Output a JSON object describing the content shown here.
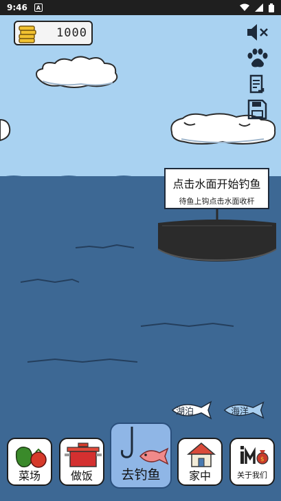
{
  "status_bar": {
    "time": "9:46",
    "notification": "A"
  },
  "coins": {
    "amount": "1000"
  },
  "side_icons": [
    "sound-off-icon",
    "paw-icon",
    "notes-icon",
    "save-icon"
  ],
  "tooltip": {
    "title": "点击水面开始钓鱼",
    "subtitle": "待鱼上钩点击水面收杆"
  },
  "fish_tags": {
    "lake": "湖泊",
    "ocean": "海洋"
  },
  "nav": {
    "vegetables": "菜场",
    "cooking": "做饭",
    "fishing": "去钓鱼",
    "home": "家中",
    "about": "关于我们"
  },
  "colors": {
    "sky": "#a9d2f1",
    "sea": "#3d6894",
    "boat": "#2b2b2b",
    "nav_active": "#8fb6e6"
  }
}
